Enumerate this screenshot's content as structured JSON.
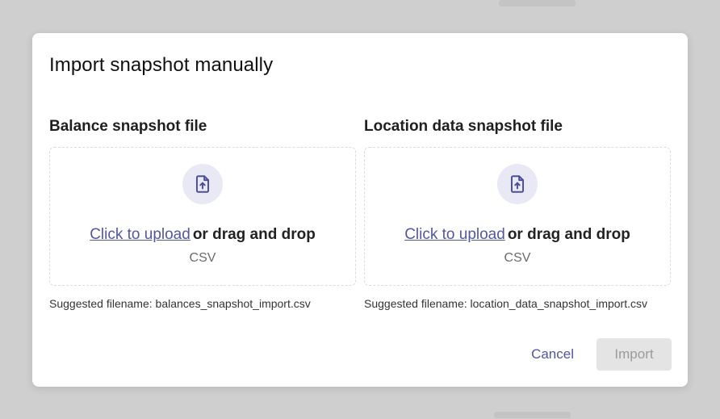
{
  "dialog": {
    "title": "Import snapshot manually",
    "balance": {
      "label": "Balance snapshot file",
      "upload_link": "Click to upload",
      "upload_rest": "or drag and drop",
      "file_type": "CSV",
      "suggested": "Suggested filename: balances_snapshot_import.csv",
      "icon": "file-upload-icon"
    },
    "location": {
      "label": "Location data snapshot file",
      "upload_link": "Click to upload",
      "upload_rest": "or drag and drop",
      "file_type": "CSV",
      "suggested": "Suggested filename: location_data_snapshot_import.csv",
      "icon": "file-upload-icon"
    },
    "actions": {
      "cancel_label": "Cancel",
      "import_label": "Import",
      "import_disabled": true
    }
  },
  "colors": {
    "accent": "#5257a0",
    "icon_bg": "#e8e9f4",
    "backdrop": "#cfcfcf",
    "disabled_bg": "#e4e4e4"
  }
}
